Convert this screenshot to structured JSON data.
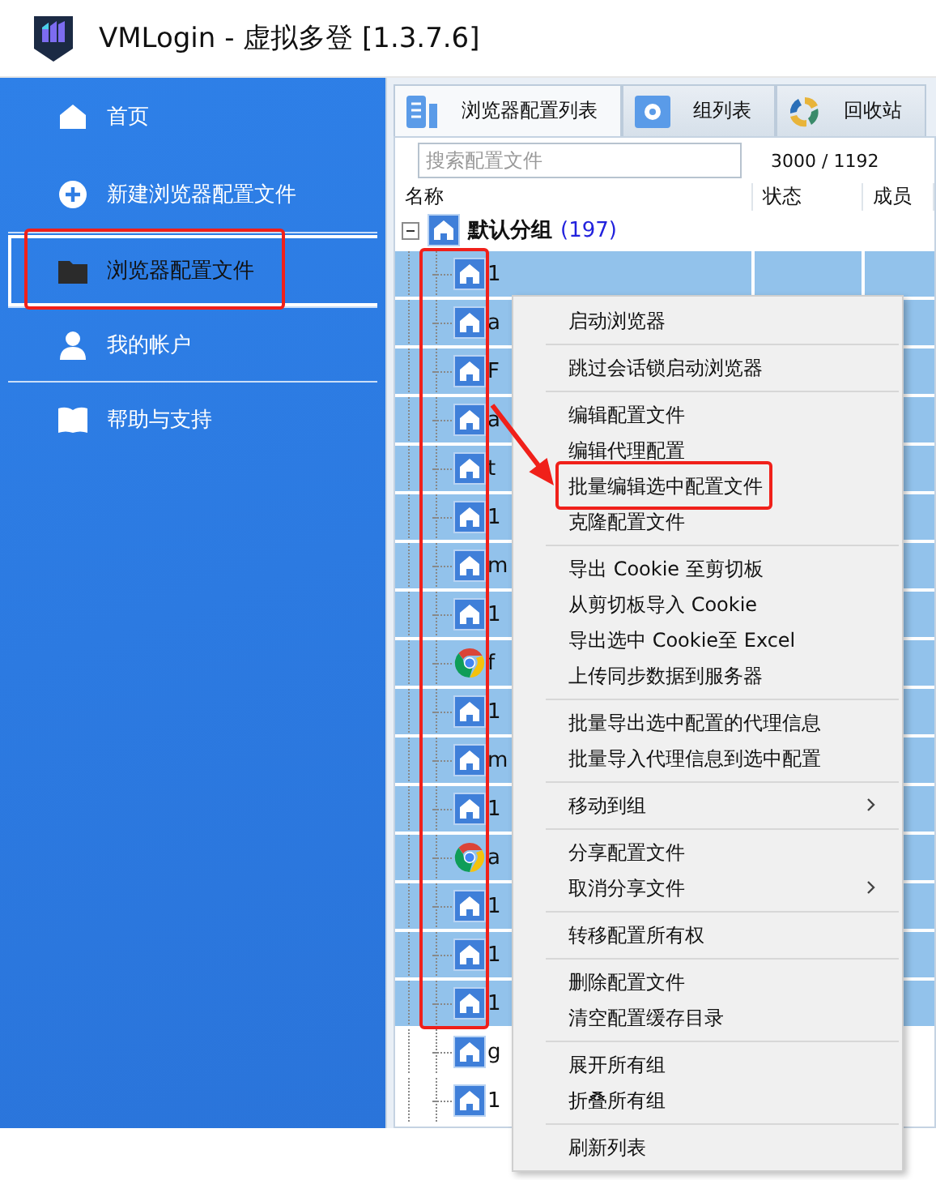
{
  "window": {
    "title": "VMLogin - 虚拟多登 [1.3.7.6]"
  },
  "sidebar": {
    "items": [
      {
        "label": "首页",
        "selected": false,
        "marked": false
      },
      {
        "label": "新建浏览器配置文件",
        "selected": false,
        "marked": false
      },
      {
        "label": "浏览器配置文件",
        "selected": true,
        "marked": true
      },
      {
        "label": "我的帐户",
        "selected": false,
        "marked": false
      },
      {
        "label": "帮助与支持",
        "selected": false,
        "marked": false
      }
    ]
  },
  "tabs": [
    {
      "label": "浏览器配置列表",
      "selected": true
    },
    {
      "label": "组列表",
      "selected": false
    },
    {
      "label": "回收站",
      "selected": false
    }
  ],
  "search": {
    "placeholder": "搜索配置文件"
  },
  "count": "3000 / 1192",
  "table": {
    "columns": [
      "名称",
      "状态",
      "成员"
    ],
    "group": {
      "name": "默认分组",
      "count": "(197)",
      "expanded": true
    },
    "rows": [
      {
        "name": "1",
        "kind": "profile",
        "selected": true,
        "marked": true
      },
      {
        "name": "a",
        "kind": "profile",
        "selected": true,
        "marked": true
      },
      {
        "name": "F",
        "kind": "profile",
        "selected": true,
        "marked": true
      },
      {
        "name": "a",
        "kind": "profile",
        "selected": true,
        "marked": true
      },
      {
        "name": "t",
        "kind": "profile",
        "selected": true,
        "marked": true
      },
      {
        "name": "1",
        "kind": "profile",
        "selected": true,
        "marked": true
      },
      {
        "name": "m",
        "kind": "profile",
        "selected": true,
        "marked": true
      },
      {
        "name": "1",
        "kind": "profile",
        "selected": true,
        "marked": true
      },
      {
        "name": "f",
        "kind": "chrome",
        "selected": true,
        "marked": true
      },
      {
        "name": "1",
        "kind": "profile",
        "selected": true,
        "marked": true
      },
      {
        "name": "m",
        "kind": "profile",
        "selected": true,
        "marked": true
      },
      {
        "name": "1",
        "kind": "profile",
        "selected": true,
        "marked": true
      },
      {
        "name": "a",
        "kind": "chrome",
        "selected": true,
        "marked": true
      },
      {
        "name": "1",
        "kind": "profile",
        "selected": true,
        "marked": true
      },
      {
        "name": "1",
        "kind": "profile",
        "selected": true,
        "marked": true
      },
      {
        "name": "1",
        "kind": "profile",
        "selected": true,
        "marked": true
      },
      {
        "name": "g",
        "kind": "profile",
        "selected": false,
        "marked": false
      },
      {
        "name": "1",
        "kind": "profile",
        "selected": false,
        "marked": false
      }
    ]
  },
  "context_menu": {
    "groups": [
      [
        {
          "label": "启动浏览器",
          "submenu": false,
          "marked": false
        }
      ],
      [
        {
          "label": "跳过会话锁启动浏览器",
          "submenu": false,
          "marked": false
        }
      ],
      [
        {
          "label": "编辑配置文件",
          "submenu": false,
          "marked": false
        },
        {
          "label": "编辑代理配置",
          "submenu": false,
          "marked": false
        },
        {
          "label": "批量编辑选中配置文件",
          "submenu": false,
          "marked": true
        },
        {
          "label": "克隆配置文件",
          "submenu": false,
          "marked": false
        }
      ],
      [
        {
          "label": "导出 Cookie 至剪切板",
          "submenu": false,
          "marked": false
        },
        {
          "label": "从剪切板导入 Cookie",
          "submenu": false,
          "marked": false
        },
        {
          "label": "导出选中 Cookie至 Excel",
          "submenu": false,
          "marked": false
        },
        {
          "label": "上传同步数据到服务器",
          "submenu": false,
          "marked": false
        }
      ],
      [
        {
          "label": "批量导出选中配置的代理信息",
          "submenu": false,
          "marked": false
        },
        {
          "label": "批量导入代理信息到选中配置",
          "submenu": false,
          "marked": false
        }
      ],
      [
        {
          "label": "移动到组",
          "submenu": true,
          "marked": false
        }
      ],
      [
        {
          "label": "分享配置文件",
          "submenu": false,
          "marked": false
        },
        {
          "label": "取消分享文件",
          "submenu": true,
          "marked": false
        }
      ],
      [
        {
          "label": "转移配置所有权",
          "submenu": false,
          "marked": false
        }
      ],
      [
        {
          "label": "删除配置文件",
          "submenu": false,
          "marked": false
        },
        {
          "label": "清空配置缓存目录",
          "submenu": false,
          "marked": false
        }
      ],
      [
        {
          "label": "展开所有组",
          "submenu": false,
          "marked": false
        },
        {
          "label": "折叠所有组",
          "submenu": false,
          "marked": false
        }
      ],
      [
        {
          "label": "刷新列表",
          "submenu": false,
          "marked": false
        }
      ]
    ]
  }
}
